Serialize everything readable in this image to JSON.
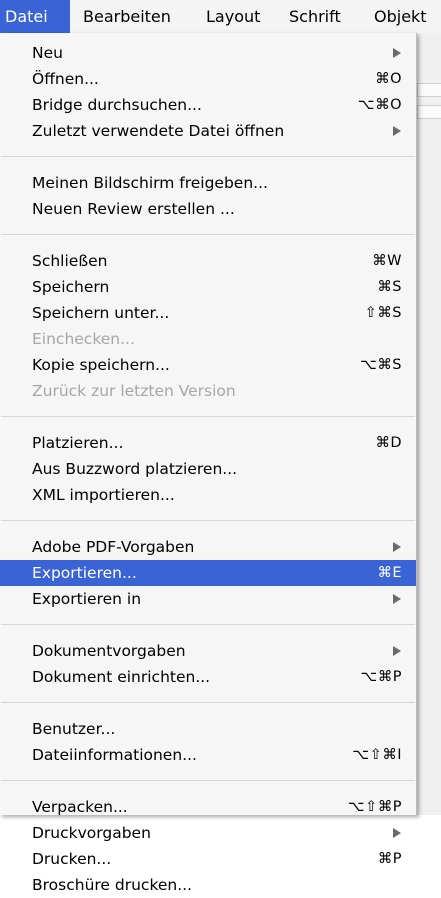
{
  "menubar": {
    "items": [
      {
        "label": "Datei",
        "active": true
      },
      {
        "label": "Bearbeiten",
        "active": false
      },
      {
        "label": "Layout",
        "active": false
      },
      {
        "label": "Schrift",
        "active": false
      },
      {
        "label": "Objekt",
        "active": false
      }
    ]
  },
  "menu": {
    "groups": [
      [
        {
          "label": "Neu",
          "shortcut": "",
          "submenu": true,
          "disabled": false,
          "highlighted": false
        },
        {
          "label": "Öffnen...",
          "shortcut": "⌘O",
          "submenu": false,
          "disabled": false,
          "highlighted": false
        },
        {
          "label": "Bridge durchsuchen...",
          "shortcut": "⌥⌘O",
          "submenu": false,
          "disabled": false,
          "highlighted": false
        },
        {
          "label": "Zuletzt verwendete Datei öffnen",
          "shortcut": "",
          "submenu": true,
          "disabled": false,
          "highlighted": false
        }
      ],
      [
        {
          "label": "Meinen Bildschirm freigeben...",
          "shortcut": "",
          "submenu": false,
          "disabled": false,
          "highlighted": false
        },
        {
          "label": "Neuen Review erstellen ...",
          "shortcut": "",
          "submenu": false,
          "disabled": false,
          "highlighted": false
        }
      ],
      [
        {
          "label": "Schließen",
          "shortcut": "⌘W",
          "submenu": false,
          "disabled": false,
          "highlighted": false
        },
        {
          "label": "Speichern",
          "shortcut": "⌘S",
          "submenu": false,
          "disabled": false,
          "highlighted": false
        },
        {
          "label": "Speichern unter...",
          "shortcut": "⇧⌘S",
          "submenu": false,
          "disabled": false,
          "highlighted": false
        },
        {
          "label": "Einchecken...",
          "shortcut": "",
          "submenu": false,
          "disabled": true,
          "highlighted": false
        },
        {
          "label": "Kopie speichern...",
          "shortcut": "⌥⌘S",
          "submenu": false,
          "disabled": false,
          "highlighted": false
        },
        {
          "label": "Zurück zur letzten Version",
          "shortcut": "",
          "submenu": false,
          "disabled": true,
          "highlighted": false
        }
      ],
      [
        {
          "label": "Platzieren...",
          "shortcut": "⌘D",
          "submenu": false,
          "disabled": false,
          "highlighted": false
        },
        {
          "label": "Aus Buzzword platzieren...",
          "shortcut": "",
          "submenu": false,
          "disabled": false,
          "highlighted": false
        },
        {
          "label": "XML importieren...",
          "shortcut": "",
          "submenu": false,
          "disabled": false,
          "highlighted": false
        }
      ],
      [
        {
          "label": "Adobe PDF-Vorgaben",
          "shortcut": "",
          "submenu": true,
          "disabled": false,
          "highlighted": false
        },
        {
          "label": "Exportieren...",
          "shortcut": "⌘E",
          "submenu": false,
          "disabled": false,
          "highlighted": true
        },
        {
          "label": "Exportieren in",
          "shortcut": "",
          "submenu": true,
          "disabled": false,
          "highlighted": false
        }
      ],
      [
        {
          "label": "Dokumentvorgaben",
          "shortcut": "",
          "submenu": true,
          "disabled": false,
          "highlighted": false
        },
        {
          "label": "Dokument einrichten...",
          "shortcut": "⌥⌘P",
          "submenu": false,
          "disabled": false,
          "highlighted": false
        }
      ],
      [
        {
          "label": "Benutzer...",
          "shortcut": "",
          "submenu": false,
          "disabled": false,
          "highlighted": false
        },
        {
          "label": "Dateiinformationen...",
          "shortcut": "⌥⇧⌘I",
          "submenu": false,
          "disabled": false,
          "highlighted": false
        }
      ],
      [
        {
          "label": "Verpacken...",
          "shortcut": "⌥⇧⌘P",
          "submenu": false,
          "disabled": false,
          "highlighted": false
        },
        {
          "label": "Druckvorgaben",
          "shortcut": "",
          "submenu": true,
          "disabled": false,
          "highlighted": false
        },
        {
          "label": "Drucken...",
          "shortcut": "⌘P",
          "submenu": false,
          "disabled": false,
          "highlighted": false
        },
        {
          "label": "Broschüre drucken...",
          "shortcut": "",
          "submenu": false,
          "disabled": false,
          "highlighted": false
        }
      ]
    ]
  },
  "colors": {
    "highlight": "#3a63d6",
    "disabled_text": "#a6a6a6",
    "menu_background": "#f6f6f6"
  }
}
